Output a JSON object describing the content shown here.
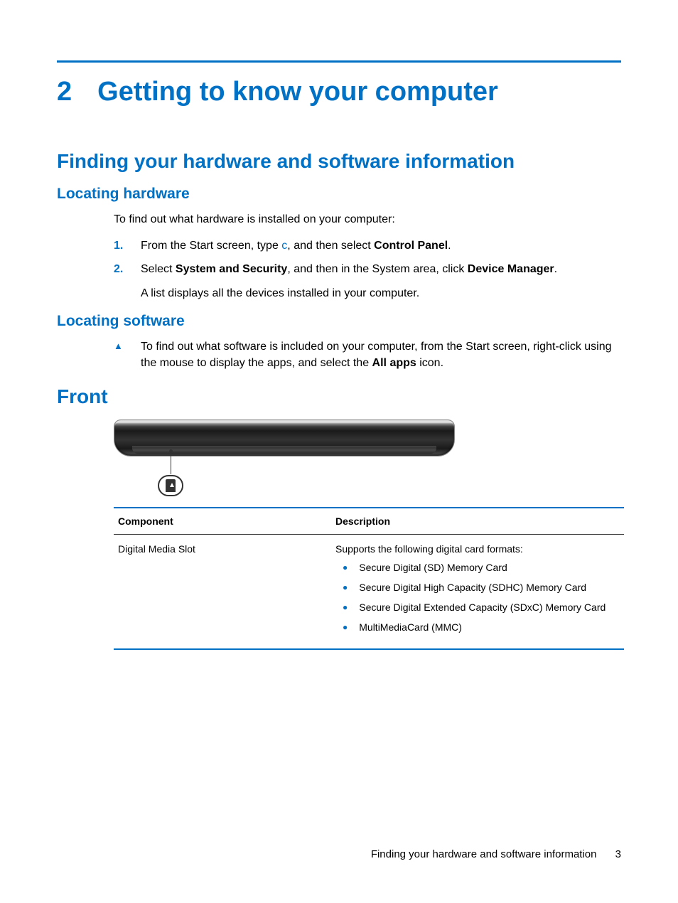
{
  "chapter": {
    "number": "2",
    "title": "Getting to know your computer"
  },
  "section1": {
    "heading": "Finding your hardware and software information",
    "hw": {
      "heading": "Locating hardware",
      "intro": "To find out what hardware is installed on your computer:",
      "steps": [
        {
          "n": "1.",
          "pre": "From the Start screen, type ",
          "key": "c",
          "mid": ", and then select ",
          "bold": "Control Panel",
          "post": "."
        },
        {
          "n": "2.",
          "pre": "Select ",
          "bold1": "System and Security",
          "mid": ", and then in the System area, click ",
          "bold2": "Device Manager",
          "post": ".",
          "tail": "A list displays all the devices installed in your computer."
        }
      ]
    },
    "sw": {
      "heading": "Locating software",
      "item": {
        "pre": "To find out what software is included on your computer, from the Start screen, right-click using the mouse to display the apps, and select the ",
        "bold": "All apps",
        "post": " icon."
      }
    }
  },
  "front": {
    "heading": "Front",
    "table": {
      "headers": {
        "c1": "Component",
        "c2": "Description"
      },
      "row": {
        "component": "Digital Media Slot",
        "descIntro": "Supports the following digital card formats:",
        "bullets": [
          "Secure Digital (SD) Memory Card",
          "Secure Digital High Capacity (SDHC) Memory Card",
          "Secure Digital Extended Capacity (SDxC) Memory Card",
          "MultiMediaCard (MMC)"
        ]
      }
    }
  },
  "footer": {
    "text": "Finding your hardware and software information",
    "page": "3"
  }
}
